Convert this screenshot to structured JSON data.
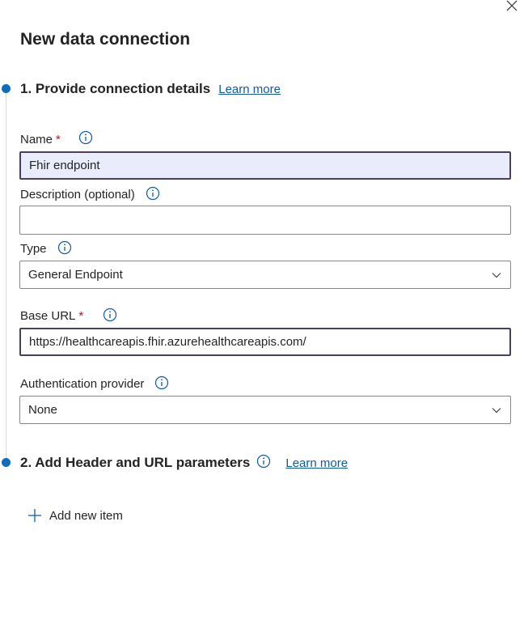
{
  "panel": {
    "title": "New data connection",
    "close_icon": "close-icon"
  },
  "step1": {
    "title": "1. Provide connection details",
    "learn_more": "Learn more"
  },
  "fields": {
    "name": {
      "label": "Name",
      "required_mark": "*",
      "value": "Fhir endpoint"
    },
    "description": {
      "label": "Description (optional)",
      "value": ""
    },
    "type": {
      "label": "Type",
      "selected": "General Endpoint"
    },
    "base_url": {
      "label": "Base URL",
      "required_mark": "*",
      "value": "https://healthcareapis.fhir.azurehealthcareapis.com/"
    },
    "auth_provider": {
      "label": "Authentication provider",
      "selected": "None"
    }
  },
  "step2": {
    "title": "2. Add Header and URL parameters",
    "learn_more": "Learn more",
    "add_item_label": "Add new item"
  },
  "colors": {
    "accent": "#0f6cbd",
    "link": "#0f5aa8",
    "required": "#c50f1f",
    "filled_input_bg": "#e8ecfb",
    "focused_border": "#4a3f5f"
  }
}
